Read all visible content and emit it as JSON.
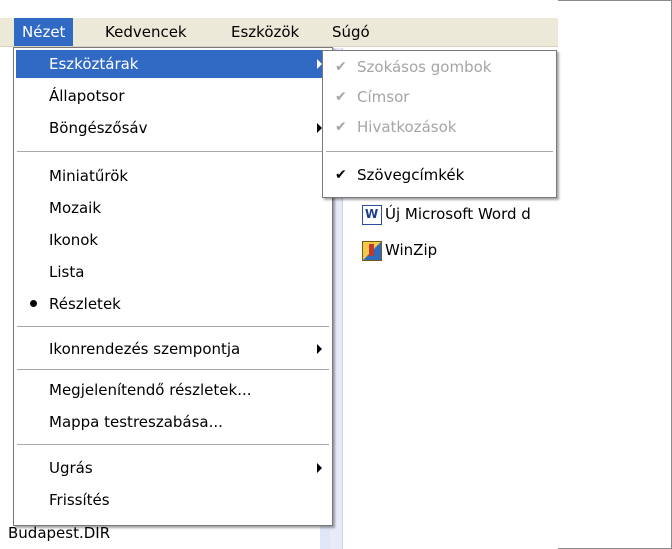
{
  "menubar": {
    "items": [
      "Nézet",
      "Kedvencek",
      "Eszközök",
      "Súgó"
    ],
    "active_index": 0
  },
  "view_menu": {
    "items": [
      {
        "label": "Eszköztárak",
        "submenu": true,
        "highlighted": true
      },
      {
        "label": "Állapotsor"
      },
      {
        "label": "Böngészősáv",
        "submenu": true
      },
      {
        "label": "Miniatűrök"
      },
      {
        "label": "Mozaik"
      },
      {
        "label": "Ikonok"
      },
      {
        "label": "Lista"
      },
      {
        "label": "Részletek",
        "bullet": true
      },
      {
        "label": "Ikonrendezés szempontja",
        "submenu": true
      },
      {
        "label": "Megjelenítendő részletek..."
      },
      {
        "label": "Mappa testreszabása..."
      },
      {
        "label": "Ugrás",
        "submenu": true
      },
      {
        "label": "Frissítés"
      }
    ]
  },
  "toolbars_submenu": {
    "items": [
      {
        "label": "Szokásos gombok",
        "checked": true,
        "enabled": false
      },
      {
        "label": "Címsor",
        "checked": true,
        "enabled": false
      },
      {
        "label": "Hivatkozások",
        "checked": true,
        "enabled": false
      },
      {
        "label": "Szövegcímkék",
        "checked": true,
        "enabled": true
      }
    ]
  },
  "files": [
    {
      "name": "Új Microsoft Word d",
      "icon": "word-document-icon"
    },
    {
      "name": "WinZip",
      "icon": "winzip-icon"
    }
  ],
  "background_item": "Budapest.DIR",
  "colors": {
    "menu_highlight": "#316ac5",
    "menubar_bg": "#ece9d8",
    "disabled_text": "#a5a5a5"
  }
}
